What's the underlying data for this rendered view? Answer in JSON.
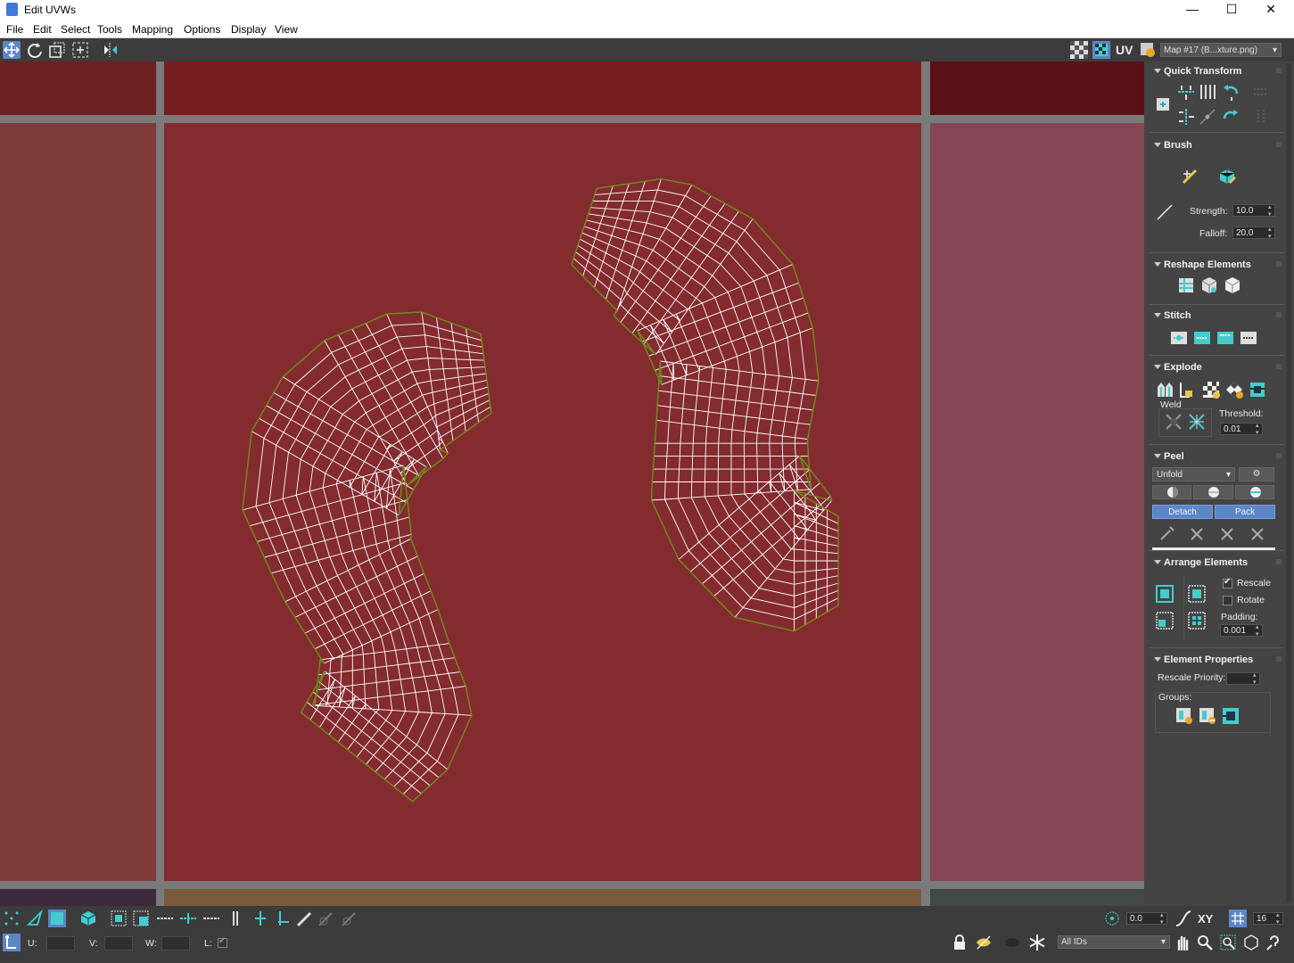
{
  "window": {
    "title": "Edit UVWs",
    "controls": [
      "—",
      "☐",
      "✕"
    ]
  },
  "menu": [
    "File",
    "Edit",
    "Select",
    "Tools",
    "Mapping",
    "Options",
    "Display",
    "View"
  ],
  "toolbar": {
    "uv_label": "UV",
    "map_select": "Map #17 (B...xture.png)"
  },
  "panel": {
    "quick_transform": "Quick Transform",
    "brush": {
      "title": "Brush",
      "strength_label": "Strength:",
      "strength": "10.0",
      "falloff_label": "Falloff:",
      "falloff": "20.0"
    },
    "reshape": "Reshape Elements",
    "stitch": "Stitch",
    "explode": {
      "title": "Explode",
      "weld_label": "Weld",
      "threshold_label": "Threshold:",
      "threshold": "0.01"
    },
    "peel": {
      "title": "Peel",
      "mode": "Unfold",
      "detach": "Detach",
      "pack": "Pack"
    },
    "arrange": {
      "title": "Arrange Elements",
      "rescale": "Rescale",
      "rotate": "Rotate",
      "padding_label": "Padding:",
      "padding": "0.001",
      "rescale_checked": true,
      "rotate_checked": false
    },
    "element_props": {
      "title": "Element Properties",
      "priority_label": "Rescale Priority:",
      "groups_label": "Groups:"
    }
  },
  "status": {
    "u_label": "U:",
    "v_label": "V:",
    "w_label": "W:",
    "l_label": "L:",
    "angle": "0.0",
    "xy": "XY",
    "grid": "16",
    "ids": "All IDs"
  },
  "colors": {
    "uv_bg": "#832b2f",
    "grid_line": "#7a7a7a",
    "wire": "#ffffff",
    "seam": "#6f8a18",
    "accent": "#5b86c8"
  }
}
